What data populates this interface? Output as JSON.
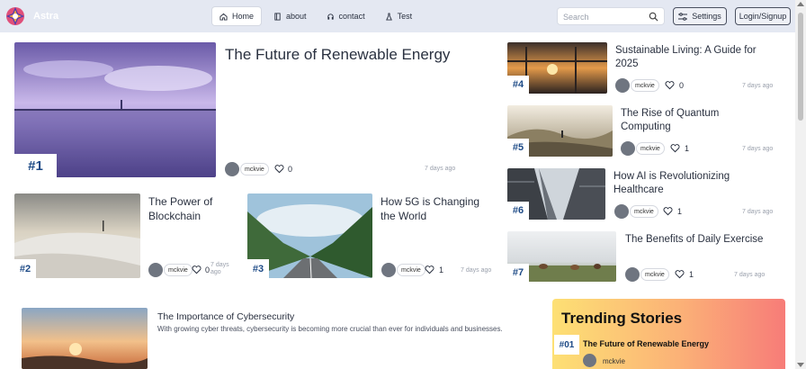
{
  "header": {
    "brand": "Astra",
    "nav": [
      {
        "label": "Home",
        "icon": "home-icon",
        "active": true
      },
      {
        "label": "about",
        "icon": "book-icon",
        "active": false
      },
      {
        "label": "contact",
        "icon": "headset-icon",
        "active": false
      },
      {
        "label": "Test",
        "icon": "flask-icon",
        "active": false
      }
    ],
    "search_placeholder": "Search",
    "settings_label": "Settings",
    "login_label": "Login/Signup"
  },
  "articles": [
    {
      "rank": "#1",
      "title": "The Future of Renewable Energy",
      "author": "mckvie",
      "likes": "0",
      "time": "7 days ago"
    },
    {
      "rank": "#2",
      "title": "The Power of Blockchain",
      "author": "mckvie",
      "likes": "0",
      "time": "7 days ago"
    },
    {
      "rank": "#3",
      "title": "How 5G is Changing the World",
      "author": "mckvie",
      "likes": "1",
      "time": "7 days ago"
    },
    {
      "rank": "#4",
      "title": "Sustainable Living: A Guide for 2025",
      "author": "mckvie",
      "likes": "0",
      "time": "7 days ago"
    },
    {
      "rank": "#5",
      "title": "The Rise of Quantum Computing",
      "author": "mckvie",
      "likes": "1",
      "time": "7 days ago"
    },
    {
      "rank": "#6",
      "title": "How AI is Revolutionizing Healthcare",
      "author": "mckvie",
      "likes": "1",
      "time": "7 days ago"
    },
    {
      "rank": "#7",
      "title": "The Benefits of Daily Exercise",
      "author": "mckvie",
      "likes": "1",
      "time": "7 days ago"
    }
  ],
  "feature": {
    "title": "The Importance of Cybersecurity",
    "description": "With growing cyber threats, cybersecurity is becoming more crucial than ever for individuals and businesses."
  },
  "trending": {
    "heading": "Trending Stories",
    "items": [
      {
        "rank": "#01",
        "title": "The Future of Renewable Energy",
        "author": "mckvie"
      }
    ]
  },
  "colors": {
    "accent": "#1d4a86",
    "header_bg": "#e4e8f2"
  }
}
